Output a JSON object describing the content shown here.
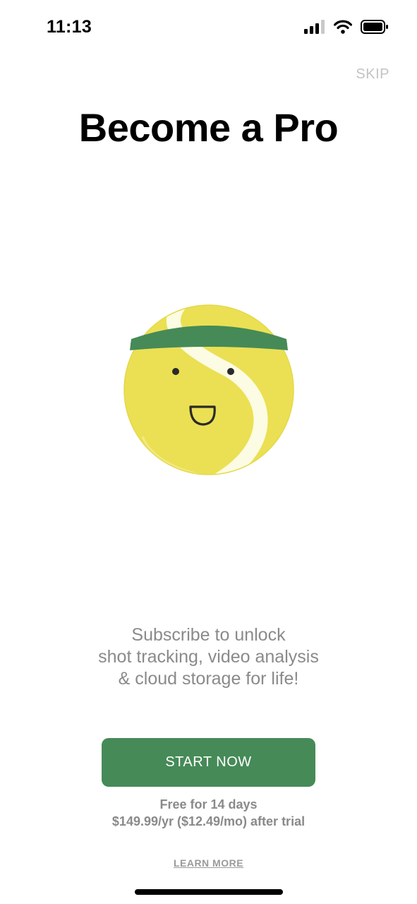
{
  "status_bar": {
    "time": "11:13",
    "icons": [
      "signal-icon",
      "wifi-icon",
      "battery-icon"
    ]
  },
  "skip_label": "SKIP",
  "title": "Become a Pro",
  "mascot": {
    "name": "tennis-ball-mascot-icon",
    "colors": {
      "ball": "#ebe053",
      "seam": "#fcfbe3",
      "headband": "#468a58"
    }
  },
  "subtitle_lines": [
    "Subscribe to unlock",
    "shot tracking, video analysis",
    "& cloud storage for life!"
  ],
  "cta_label": "START NOW",
  "trial_lines": [
    "Free for 14 days",
    "$149.99/yr ($12.49/mo) after trial"
  ],
  "learn_more_label": "LEARN MORE",
  "colors": {
    "accent": "#468a58",
    "muted_text": "#8a8a8a",
    "skip": "#c3c3c3"
  }
}
